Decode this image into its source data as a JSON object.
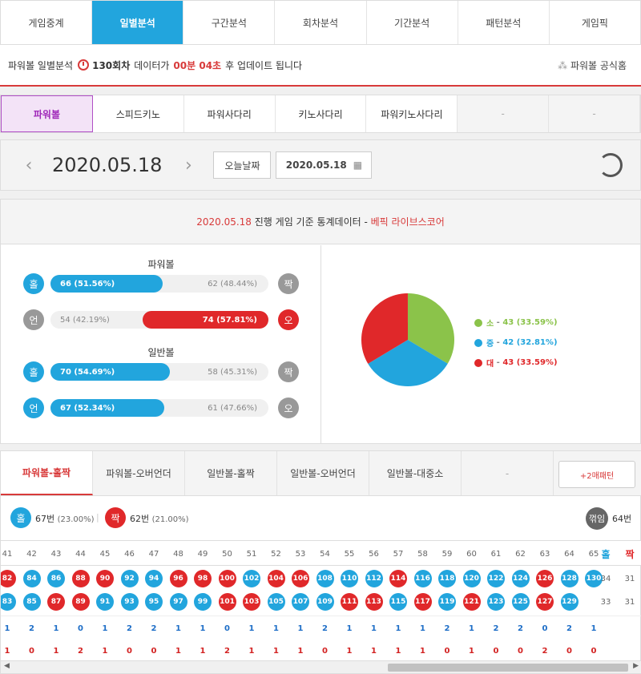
{
  "topnav": [
    "게임중계",
    "일별분석",
    "구간분석",
    "회차분석",
    "기간분석",
    "패턴분석",
    "게임픽"
  ],
  "info": {
    "prefix": "파워볼 일별분석",
    "round": "130회차",
    "mid": "데이터가",
    "time": "00분 04초",
    "suffix": "후 업데이트 됩니다",
    "link": "파워볼 공식홈"
  },
  "gametabs": [
    "파워볼",
    "스피드키노",
    "파워사다리",
    "키노사다리",
    "파워키노사다리",
    "-",
    "-"
  ],
  "datebar": {
    "date": "2020.05.18",
    "today_btn": "오늘날짜",
    "date_btn": "2020.05.18"
  },
  "stat": {
    "date": "2020.05.18",
    "mid": " 진행 게임 기준 통계데이터 - ",
    "brand": "베픽 라이브스코어"
  },
  "powerball": {
    "title": "파워볼",
    "odd": {
      "left_label": "홀",
      "right_label": "짝",
      "left": "66 (51.56%)",
      "right": "62 (48.44%)",
      "ratio": 0.5156
    },
    "under": {
      "left_label": "언",
      "right_label": "오",
      "left": "54 (42.19%)",
      "right": "74 (57.81%)",
      "ratio": 0.4219
    }
  },
  "normalball": {
    "title": "일반볼",
    "odd": {
      "left_label": "홀",
      "right_label": "짝",
      "left": "70 (54.69%)",
      "right": "58 (45.31%)",
      "ratio": 0.5469
    },
    "under": {
      "left_label": "언",
      "right_label": "오",
      "left": "67 (52.34%)",
      "right": "61 (47.66%)",
      "ratio": 0.5234
    }
  },
  "pie": {
    "legend": [
      {
        "label": "소",
        "value": "43 (33.59%)",
        "color": "#8bc34a",
        "ratio": 0.3359
      },
      {
        "label": "중",
        "value": "42 (32.81%)",
        "color": "#22a5dd",
        "ratio": 0.3281
      },
      {
        "label": "대",
        "value": "43 (33.59%)",
        "color": "#e0282a",
        "ratio": 0.3359
      }
    ]
  },
  "ptabs": [
    "파워볼-홀짝",
    "파워볼-오버언더",
    "일반볼-홀짝",
    "일반볼-오버언더",
    "일반볼-대중소",
    "-"
  ],
  "more_btn": "+2매패턴",
  "summary": {
    "odd_label": "홀",
    "odd": "67번",
    "odd_pct": "(23.00%)",
    "even_label": "짝",
    "even": "62번",
    "even_pct": "(21.00%)",
    "break_label": "꺾임",
    "break": "64번"
  },
  "grid": {
    "cols": [
      "41",
      "42",
      "43",
      "44",
      "45",
      "46",
      "47",
      "48",
      "49",
      "50",
      "51",
      "52",
      "53",
      "54",
      "55",
      "56",
      "57",
      "58",
      "59",
      "60",
      "61",
      "62",
      "63",
      "64",
      "65"
    ],
    "right_headers": [
      "홀",
      "짝"
    ],
    "row1": [
      [
        "82",
        "r"
      ],
      [
        "84",
        "b"
      ],
      [
        "86",
        "b"
      ],
      [
        "88",
        "r"
      ],
      [
        "90",
        "r"
      ],
      [
        "92",
        "b"
      ],
      [
        "94",
        "b"
      ],
      [
        "96",
        "r"
      ],
      [
        "98",
        "r"
      ],
      [
        "100",
        "r"
      ],
      [
        "102",
        "b"
      ],
      [
        "104",
        "r"
      ],
      [
        "106",
        "r"
      ],
      [
        "108",
        "b"
      ],
      [
        "110",
        "b"
      ],
      [
        "112",
        "b"
      ],
      [
        "114",
        "r"
      ],
      [
        "116",
        "b"
      ],
      [
        "118",
        "b"
      ],
      [
        "120",
        "b"
      ],
      [
        "122",
        "b"
      ],
      [
        "124",
        "b"
      ],
      [
        "126",
        "r"
      ],
      [
        "128",
        "b"
      ],
      [
        "130",
        "b"
      ]
    ],
    "row2": [
      [
        "83",
        "b"
      ],
      [
        "85",
        "b"
      ],
      [
        "87",
        "r"
      ],
      [
        "89",
        "r"
      ],
      [
        "91",
        "b"
      ],
      [
        "93",
        "b"
      ],
      [
        "95",
        "b"
      ],
      [
        "97",
        "b"
      ],
      [
        "99",
        "b"
      ],
      [
        "101",
        "r"
      ],
      [
        "103",
        "r"
      ],
      [
        "105",
        "b"
      ],
      [
        "107",
        "b"
      ],
      [
        "109",
        "b"
      ],
      [
        "111",
        "r"
      ],
      [
        "113",
        "r"
      ],
      [
        "115",
        "b"
      ],
      [
        "117",
        "r"
      ],
      [
        "119",
        "b"
      ],
      [
        "121",
        "r"
      ],
      [
        "123",
        "b"
      ],
      [
        "125",
        "b"
      ],
      [
        "127",
        "r"
      ],
      [
        "129",
        "b"
      ],
      null
    ],
    "totals1": [
      "34",
      "31"
    ],
    "totals2": [
      "33",
      "31"
    ],
    "count_blue": [
      "1",
      "2",
      "1",
      "0",
      "1",
      "2",
      "2",
      "1",
      "1",
      "0",
      "1",
      "1",
      "1",
      "2",
      "1",
      "1",
      "1",
      "1",
      "2",
      "1",
      "2",
      "2",
      "0",
      "2",
      "1"
    ],
    "count_red": [
      "1",
      "0",
      "1",
      "2",
      "1",
      "0",
      "0",
      "1",
      "1",
      "2",
      "1",
      "1",
      "1",
      "0",
      "1",
      "1",
      "1",
      "1",
      "0",
      "1",
      "0",
      "0",
      "2",
      "0",
      "0"
    ]
  }
}
